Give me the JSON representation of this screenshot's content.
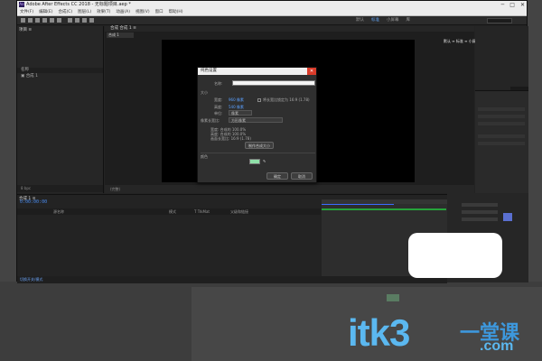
{
  "window": {
    "title": "Adobe After Effects CC 2018 - 无标题项目.aep *",
    "logo": "Ae",
    "controls": [
      "─",
      "□",
      "✕"
    ]
  },
  "menu": [
    "文件(F)",
    "编辑(E)",
    "合成(C)",
    "图层(L)",
    "效果(T)",
    "动画(A)",
    "视图(V)",
    "窗口",
    "帮助(H)"
  ],
  "workspace": {
    "tabs": [
      "默认",
      "标准",
      "小屏幕",
      "库"
    ],
    "active": "标准"
  },
  "project": {
    "tab": "项目 ≡",
    "col_name": "名称",
    "item": "合成 1",
    "footer": "8 bpc"
  },
  "composition": {
    "tab": "合成 合成 1 ≡",
    "sub_tab": "合成 1",
    "footer": "(完整)"
  },
  "info": {
    "label": "默认 ≡ 标准 ≡ 小屏幕"
  },
  "timeline": {
    "tab": "合成 1 ≡",
    "timecode": "0:00:00:00",
    "columns": [
      "源名称",
      "模式",
      "T TrkMat",
      "父级和链接"
    ],
    "footer": "切换开关/模式"
  },
  "dialog": {
    "title": "纯色设置",
    "name_label": "名称:",
    "name_value": "",
    "size_label": "大小",
    "width_label": "宽度:",
    "width_value": "960 像素",
    "height_label": "高度:",
    "height_value": "540 像素",
    "lock_label": "将长宽比锁定为 16:9 (1.78)",
    "unit_label": "单位:",
    "unit_value": "像素",
    "par_label": "像素长宽比:",
    "par_value": "方形像素",
    "info_w": "宽度: 合成的 100.0%",
    "info_h": "高度: 合成的 100.0%",
    "info_ar": "画面长宽比: 16:9 (1.78)",
    "make_comp_size": "制作合成大小",
    "color_label": "颜色",
    "eyedropper": "✎",
    "ok": "确定",
    "cancel": "取消",
    "swatch_color": "#8fe0a8"
  },
  "watermark": {
    "domain": "itk3",
    "cn": "一堂课",
    "com": ".com"
  }
}
